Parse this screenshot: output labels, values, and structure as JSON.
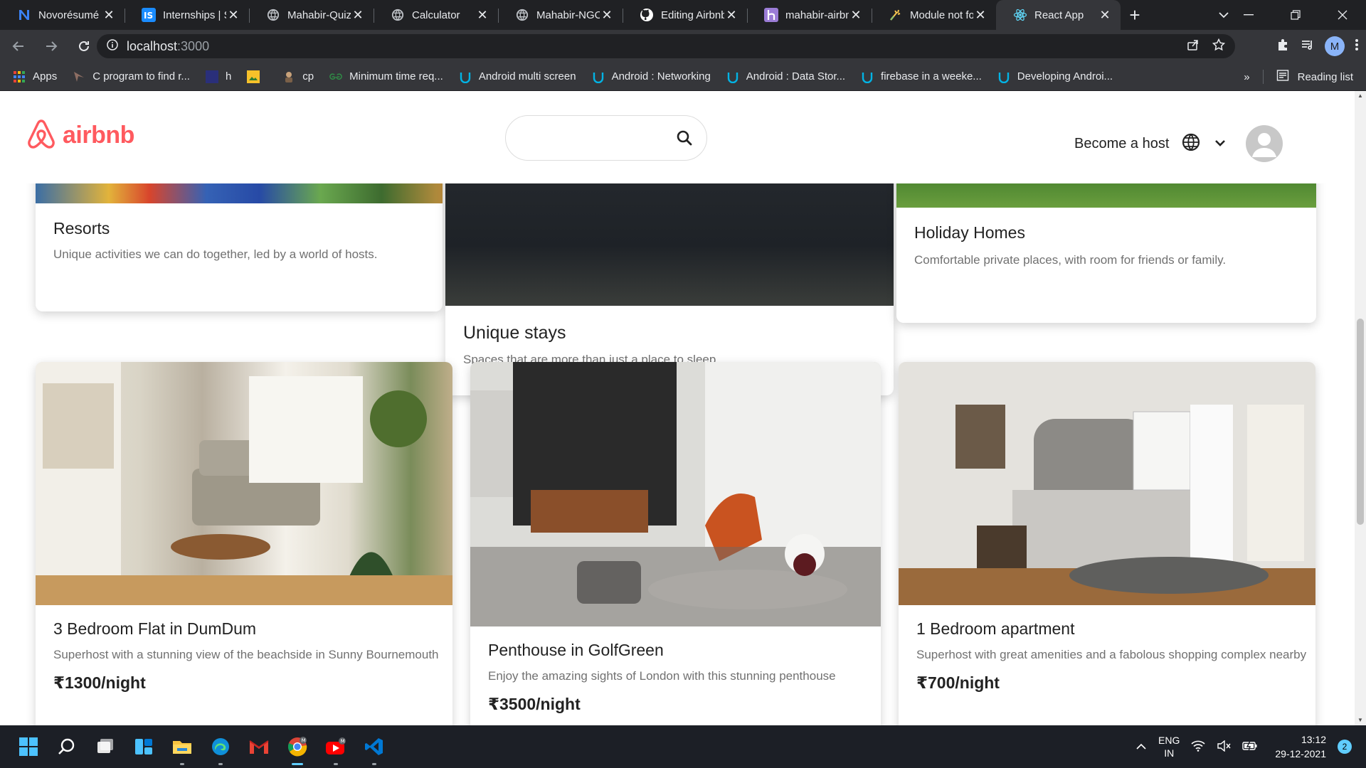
{
  "browser": {
    "tabs": [
      {
        "title": "Novorésumé",
        "icon": "novoresume-icon",
        "active": false
      },
      {
        "title": "Internships | S",
        "icon": "internshala-icon",
        "active": false
      },
      {
        "title": "Mahabir-Quiz",
        "icon": "globe-icon",
        "active": false
      },
      {
        "title": "Calculator",
        "icon": "globe-icon",
        "active": false
      },
      {
        "title": "Mahabir-NGO",
        "icon": "globe-icon",
        "active": false
      },
      {
        "title": "Editing Airbnb",
        "icon": "github-icon",
        "active": false
      },
      {
        "title": "mahabir-airbn",
        "icon": "heroku-icon",
        "active": false
      },
      {
        "title": "Module not fo",
        "icon": "codesandbox-icon",
        "active": false
      },
      {
        "title": "React App",
        "icon": "react-icon",
        "active": true
      }
    ],
    "url_host": "localhost",
    "url_port": ":3000",
    "profile_initial": "M",
    "bookmarks": [
      {
        "label": "Apps",
        "icon": "apps-grid-icon"
      },
      {
        "label": "C program to find r...",
        "icon": "site-icon"
      },
      {
        "label": "h",
        "icon": "site-icon"
      },
      {
        "label": "",
        "icon": "image-icon"
      },
      {
        "label": "cp",
        "icon": "site-icon"
      },
      {
        "label": "Minimum time req...",
        "icon": "gfg-icon"
      },
      {
        "label": "Android multi screen",
        "icon": "udacity-icon"
      },
      {
        "label": "Android : Networking",
        "icon": "udacity-icon"
      },
      {
        "label": "Android : Data Stor...",
        "icon": "udacity-icon"
      },
      {
        "label": "firebase in a weeke...",
        "icon": "udacity-icon"
      },
      {
        "label": "Developing Androi...",
        "icon": "udacity-icon"
      }
    ],
    "bookmarks_overflow": "»",
    "reading_list": "Reading list"
  },
  "header": {
    "logo_text": "airbnb",
    "search_placeholder": "",
    "become_host": "Become a host"
  },
  "categories": [
    {
      "title": "Resorts",
      "desc": "Unique activities we can do together, led by a world of hosts."
    },
    {
      "title": "Unique stays",
      "desc": "Spaces that are more than just a place to sleep."
    },
    {
      "title": "Holiday Homes",
      "desc": "Comfortable private places, with room for friends or family."
    }
  ],
  "listings": [
    {
      "title": "3 Bedroom Flat in DumDum",
      "desc": "Superhost with a stunning view of the beachside in Sunny Bournemouth",
      "price": "₹1300/night"
    },
    {
      "title": "Penthouse in GolfGreen",
      "desc": "Enjoy the amazing sights of London with this stunning penthouse",
      "price": "₹3500/night"
    },
    {
      "title": "1 Bedroom apartment",
      "desc": "Superhost with great amenities and a fabolous shopping complex nearby",
      "price": "₹700/night"
    }
  ],
  "taskbar": {
    "apps": [
      "windows-start-icon",
      "search-icon",
      "task-view-icon",
      "widgets-icon",
      "file-explorer-icon",
      "edge-icon",
      "gmail-icon",
      "chrome-icon",
      "youtube-icon",
      "vscode-icon"
    ],
    "lang_top": "ENG",
    "lang_bottom": "IN",
    "time": "13:12",
    "date": "29-12-2021",
    "notifications": "2"
  },
  "colors": {
    "brand": "#FF5A5F",
    "chrome_dark": "#202124",
    "chrome_toolbar": "#35363a"
  }
}
